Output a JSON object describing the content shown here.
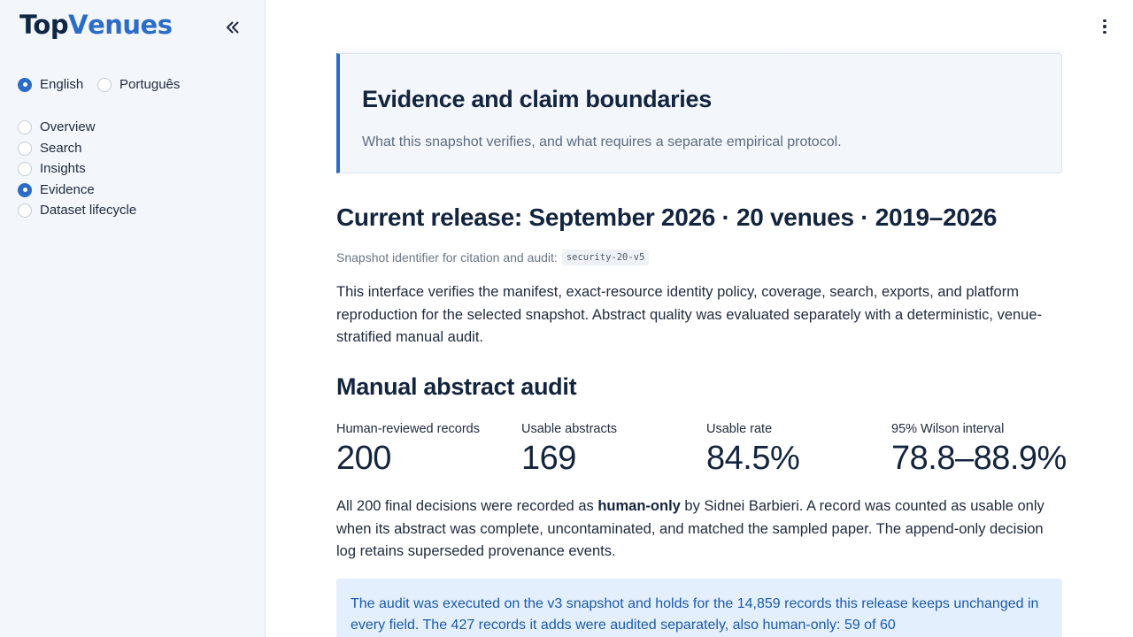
{
  "brand": {
    "part1": "Top",
    "part2": "V",
    "part3": "enues"
  },
  "colors": {
    "accent": "#2b6cc8",
    "sidebar_bg": "#f3f6fb",
    "note_bg": "#e3effc",
    "heading": "#13243e"
  },
  "sidebar": {
    "collapse_icon": "double-chevron-left-icon",
    "languages": [
      {
        "label": "English",
        "selected": true
      },
      {
        "label": "Português",
        "selected": false
      }
    ],
    "nav": [
      {
        "label": "Overview",
        "selected": false
      },
      {
        "label": "Search",
        "selected": false
      },
      {
        "label": "Insights",
        "selected": false
      },
      {
        "label": "Evidence",
        "selected": true
      },
      {
        "label": "Dataset lifecycle",
        "selected": false
      }
    ]
  },
  "header": {
    "menu_icon": "kebab-menu-icon"
  },
  "main": {
    "callout": {
      "title": "Evidence and claim boundaries",
      "subtitle": "What this snapshot verifies, and what requires a separate empirical protocol."
    },
    "release_heading": "Current release: September 2026 · 20 venues · 2019–2026",
    "snapshot_label": "Snapshot identifier for citation and audit:",
    "snapshot_id": "security-20-v5",
    "release_paragraph": "This interface verifies the manifest, exact-resource identity policy, coverage, search, exports, and platform reproduction for the selected snapshot. Abstract quality was evaluated separately with a deterministic, venue-stratified manual audit.",
    "audit_heading": "Manual abstract audit",
    "stats": [
      {
        "label": "Human-reviewed records",
        "value": "200"
      },
      {
        "label": "Usable abstracts",
        "value": "169"
      },
      {
        "label": "Usable rate",
        "value": "84.5%"
      },
      {
        "label": "95% Wilson interval",
        "value": "78.8–88.9%"
      }
    ],
    "audit_paragraph": {
      "pre": "All 200 final decisions were recorded as ",
      "bold": "human-only",
      "post": " by Sidnei Barbieri. A record was counted as usable only when its abstract was complete, uncontaminated, and matched the sampled paper. The append-only decision log retains superseded provenance events."
    },
    "note": "The audit was executed on the v3 snapshot and holds for the 14,859 records this release keeps unchanged in every field. The 427 records it adds were audited separately, also human-only: 59 of 60"
  }
}
